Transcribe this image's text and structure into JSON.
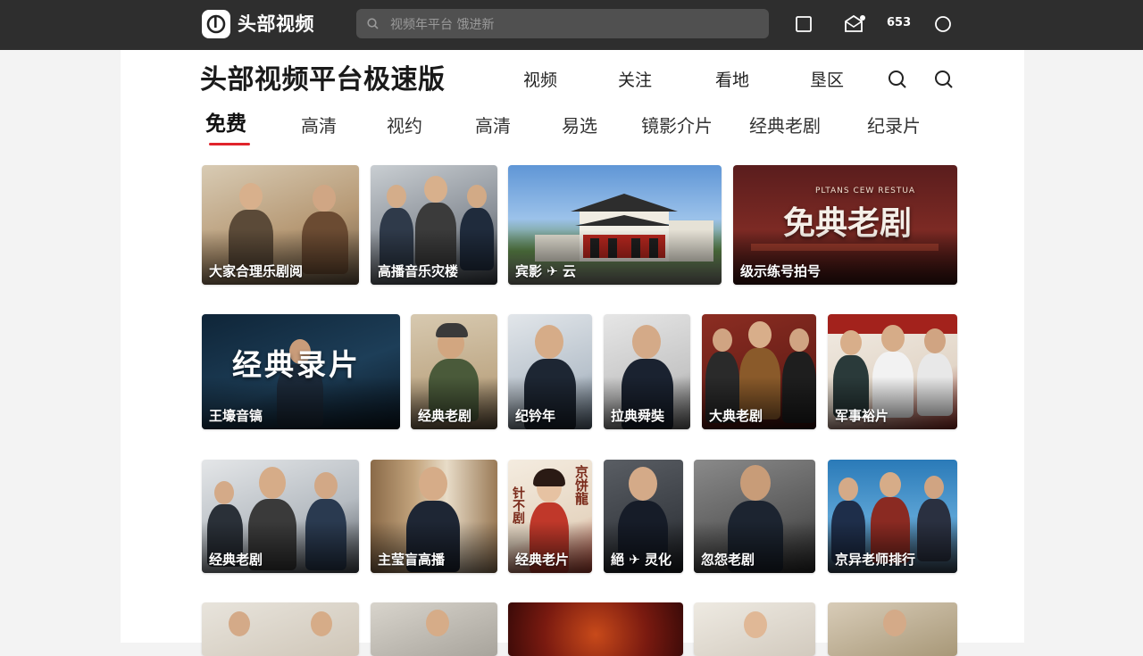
{
  "app": {
    "logo_text": "头部视频",
    "search_placeholder": "视频年平台 饿进新",
    "notification_count": "653"
  },
  "header": {
    "title": "头部视频平台极速版",
    "nav": [
      "视频",
      "关注",
      "看地",
      "垦区"
    ]
  },
  "tabs": [
    "免费",
    "高清",
    "视约",
    "高清",
    "易选",
    "镜影介片",
    "经典老剧",
    "纪录片"
  ],
  "active_tab_index": 0,
  "colors": {
    "topbar": "#2e2e2e",
    "accent": "#e0242b",
    "panel": "#ffffff",
    "page_bg": "#f3f3f3"
  },
  "cards": {
    "row1": [
      {
        "caption": "大家合理乐剧阅"
      },
      {
        "caption": "高播音乐灾楼"
      },
      {
        "caption": "宾影 ✈ 云"
      },
      {
        "caption": "级示练号拍号",
        "overlay": "免典老剧",
        "overlay_small": "PLTANS CEW RESTUA"
      }
    ],
    "row2": [
      {
        "caption": "王壕音镐",
        "overlay": "经典录片"
      },
      {
        "caption": "经典老剧"
      },
      {
        "caption": "纪钤年"
      },
      {
        "caption": "拉典舜奘"
      },
      {
        "caption": "大典老剧"
      },
      {
        "caption": "军事裕片"
      }
    ],
    "row3": [
      {
        "caption": "经典老剧"
      },
      {
        "caption": "主莹盲高播"
      },
      {
        "caption": "经典老片",
        "poster_left": "针不剧",
        "poster_right": "京饼龍"
      },
      {
        "caption": "絕 ✈ 灵化"
      },
      {
        "caption": "忽怨老剧"
      },
      {
        "caption": "京异老师排行"
      }
    ],
    "row4": [
      {
        "caption": ""
      },
      {
        "caption": ""
      },
      {
        "caption": ""
      },
      {
        "caption": ""
      },
      {
        "caption": ""
      }
    ]
  }
}
